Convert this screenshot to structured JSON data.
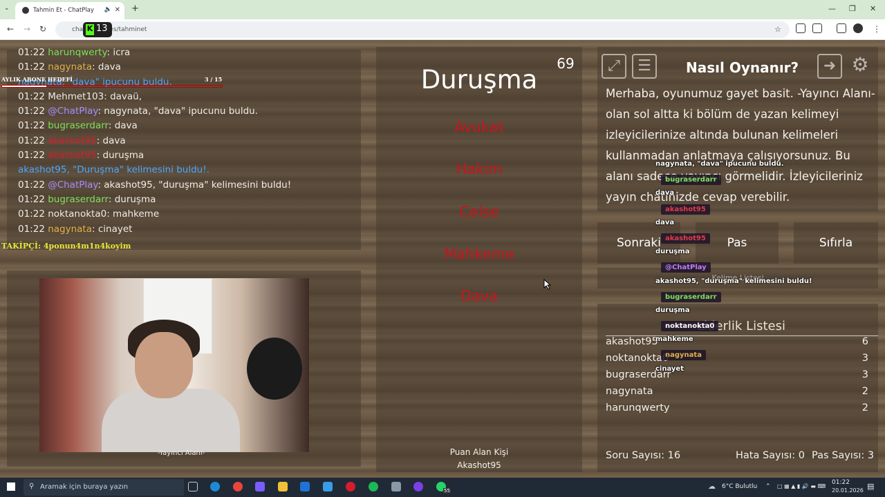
{
  "browser": {
    "tab_title": "Tahmin Et - ChatPlay",
    "url": "cha... r/games/tahminet",
    "kick_count": "13"
  },
  "chat": {
    "lines": [
      {
        "time": "01:22",
        "user": "harunqwerty",
        "sep": ": ",
        "msg": "icra",
        "color": "#7ee05a"
      },
      {
        "time": "01:22",
        "user": "nagynata",
        "sep": ": ",
        "msg": "dava",
        "color": "#e0b14d"
      },
      {
        "time": "",
        "user": "",
        "sep": "",
        "msg": "nagynata, \"dava\" ipucunu buldu.",
        "color": "#4da6ff",
        "system": true
      },
      {
        "time": "01:22",
        "user": "Mehmet103",
        "sep": ": ",
        "msg": "davaü,",
        "color": "#f0ece6"
      },
      {
        "time": "01:22",
        "user": "@ChatPlay",
        "sep": ": ",
        "msg": "nagynata, \"dava\" ipucunu buldu.",
        "color": "#a58bff"
      },
      {
        "time": "01:22",
        "user": "bugraserdarr",
        "sep": ": ",
        "msg": "dava",
        "color": "#7ee05a"
      },
      {
        "time": "01:22",
        "user": "akashot95",
        "sep": ": ",
        "msg": "dava",
        "color": "#d41e2b"
      },
      {
        "time": "01:22",
        "user": "akashot95",
        "sep": ": ",
        "msg": "duruşma",
        "color": "#d41e2b"
      },
      {
        "time": "",
        "user": "",
        "sep": "",
        "msg": "akashot95, \"Duruşma\" kelimesini buldu!.",
        "color": "#4da6ff",
        "system": true
      },
      {
        "time": "01:22",
        "user": "@ChatPlay",
        "sep": ": ",
        "msg": "akashot95, \"duruşma\" kelimesini buldu!",
        "color": "#a58bff"
      },
      {
        "time": "01:22",
        "user": "bugraserdarr",
        "sep": ": ",
        "msg": "duruşma",
        "color": "#7ee05a"
      },
      {
        "time": "01:22",
        "user": "noktanokta0",
        "sep": ": ",
        "msg": "mahkeme",
        "color": "#f0ece6"
      },
      {
        "time": "01:22",
        "user": "nagynata",
        "sep": ": ",
        "msg": "cinayet",
        "color": "#e0b14d"
      }
    ]
  },
  "goal": {
    "label": "AYLIK ABONE HEDEFİ",
    "count": "3 / 15",
    "progress": 0.2
  },
  "takipci": "TAKİPÇİ: 4ponun4m1n4koyim",
  "camera_label": "-Yayıncı Alanı-",
  "game": {
    "word": "Duruşma",
    "timer": "69",
    "taboo": [
      "Avukat",
      "Hakim",
      "Celse",
      "Mahkeme",
      "Dava"
    ],
    "scorer_label": "Puan Alan Kişi",
    "scorer_name": "Akashot95"
  },
  "howto": {
    "title": "Nasıl Oynanır?",
    "text": "Merhaba, oyunumuz gayet basit. -Yayıncı Alanı- olan sol altta ki bölüm de yazan kelimeyi izleyicilerinize altında bulunan kelimeleri kullanmadan anlatmaya çalışıyorsunuz. Bu alanı sadece yayıncı görmelidir. İzleyicileriniz yayın chatinizde cevap verebilir."
  },
  "buttons": {
    "next": "Sonraki",
    "pass": "Pas",
    "reset": "Sıfırla",
    "wordlist": "Kelime Listesi"
  },
  "leaderboard": {
    "title": "Liderlik Listesi",
    "rows": [
      {
        "name": "akashot95",
        "score": "6"
      },
      {
        "name": "noktanokta0",
        "score": "3"
      },
      {
        "name": "bugraserdarr",
        "score": "3"
      },
      {
        "name": "nagynata",
        "score": "2"
      },
      {
        "name": "harunqwerty",
        "score": "2"
      }
    ]
  },
  "stats": {
    "questions": "Soru Sayısı: 16",
    "errors": "Hata Sayısı: 0",
    "passes": "Pas Sayısı: 3"
  },
  "overlay": [
    {
      "type": "text",
      "text": "nagynata, \"dava\" ipucunu buldu."
    },
    {
      "type": "user",
      "text": "bugraserdarr",
      "color": "#7ee05a"
    },
    {
      "type": "text",
      "text": "dava"
    },
    {
      "type": "user",
      "text": "akashot95",
      "color": "#e23b4a"
    },
    {
      "type": "text",
      "text": "dava"
    },
    {
      "type": "user",
      "text": "akashot95",
      "color": "#e23b4a"
    },
    {
      "type": "text",
      "text": "duruşma"
    },
    {
      "type": "user",
      "text": "@ChatPlay",
      "color": "#c07bff"
    },
    {
      "type": "text",
      "text": "akashot95, \"duruşma\" kelimesini buldu!"
    },
    {
      "type": "user",
      "text": "bugraserdarr",
      "color": "#7ee05a"
    },
    {
      "type": "text",
      "text": "duruşma"
    },
    {
      "type": "user",
      "text": "noktanokta0",
      "color": "#ffffff"
    },
    {
      "type": "text",
      "text": "mahkeme"
    },
    {
      "type": "user",
      "text": "nagynata",
      "color": "#e0b14d"
    },
    {
      "type": "text",
      "text": "cinayet"
    }
  ],
  "taskbar": {
    "search_placeholder": "Aramak için buraya yazın",
    "weather": "6°C Bulutlu",
    "time": "01:22",
    "date": "20.01.2026",
    "whatsapp_badge": "55"
  },
  "colors": {
    "taboo": "#c8151d",
    "system_msg": "#4da6ff",
    "kick": "#53fc18"
  }
}
